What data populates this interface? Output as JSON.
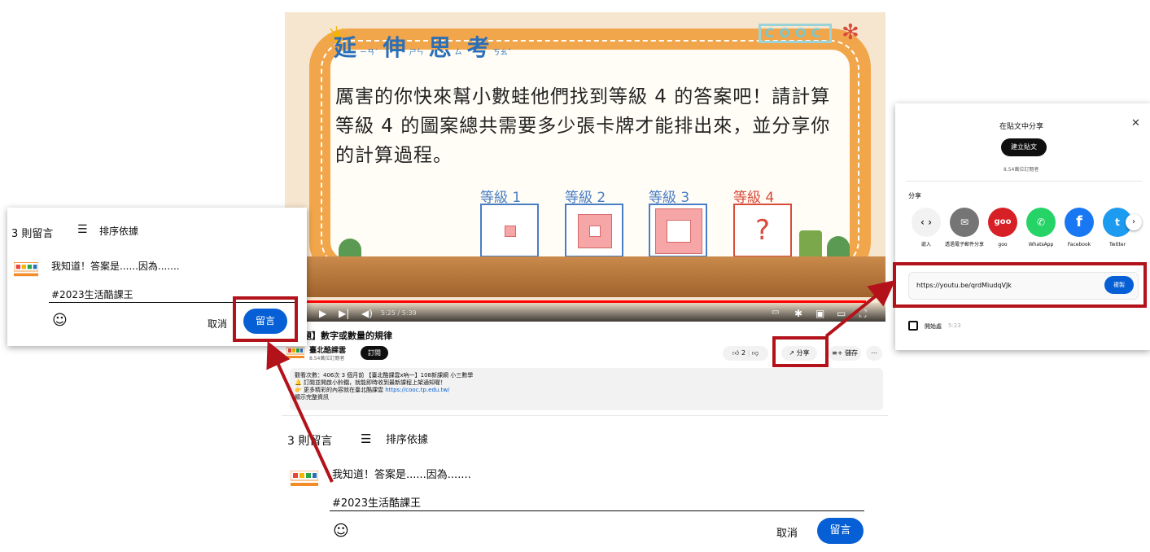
{
  "video": {
    "slide_title_chars": [
      {
        "c": "延",
        "r": "ㄧㄢˊ"
      },
      {
        "c": "伸",
        "r": "ㄕㄣ"
      },
      {
        "c": "思",
        "r": "ㄙ"
      },
      {
        "c": "考",
        "r": "ㄎㄠˇ"
      }
    ],
    "logo_text": "COOC",
    "slide_text": "厲害的你快來幫小數蛙他們找到等級 4 的答案吧！請計算等級 4 的圖案總共需要多少張卡牌才能排出來，並分享你的計算過程。",
    "levels": [
      {
        "label": "等級 1"
      },
      {
        "label": "等級 2"
      },
      {
        "label": "等級 3"
      },
      {
        "label": "等級 4",
        "mark": "?"
      }
    ],
    "time": "5:25 / 5:39",
    "progress": 0.98
  },
  "watch": {
    "title": "題】數字或數量的規律",
    "channel_name": "臺北酷課雲",
    "channel_subs": "8.54萬位訂閱者",
    "subscribe_label": "訂閱",
    "like_count": "2",
    "share_label": "分享",
    "save_label": "儲存",
    "more_label": "⋯",
    "description": {
      "line1": "觀看次數：406次 3 個月前 【臺北酷課雲x吶一】108新課綱 小三數學",
      "line2": "訂閱並開啟小鈴鐺，就能即時收到最新課程上架通知喔！",
      "line3_prefix": "更多精彩的內容就在臺北酷課雲 ",
      "line3_link": "https://cooc.tp.edu.tw/",
      "line4": "顯示完整資訊"
    }
  },
  "comments": {
    "count": "3 則留言",
    "sort_label": "排序依據",
    "draft_line1": "我知道！答案是......因為.......",
    "draft_line2": "#2023生活酷課王",
    "cancel_label": "取消",
    "submit_label": "留言"
  },
  "share": {
    "header": "在貼文中分享",
    "create_post_label": "建立貼文",
    "subs": "8.54萬位訂閱者",
    "section_label": "分享",
    "options": [
      {
        "name": "嵌入",
        "icon": "embed-icon",
        "color": "#f2f2f2",
        "glyph": "‹ ›"
      },
      {
        "name": "透過電子郵件分享",
        "icon": "email-icon",
        "color": "#757575",
        "glyph": "✉"
      },
      {
        "name": "goo",
        "icon": "goo-icon",
        "color": "#d71f26",
        "glyph": "goo"
      },
      {
        "name": "WhatsApp",
        "icon": "whatsapp-icon",
        "color": "#25d366",
        "glyph": "✆"
      },
      {
        "name": "Facebook",
        "icon": "facebook-icon",
        "color": "#1877f2",
        "glyph": "f"
      },
      {
        "name": "Twitter",
        "icon": "twitter-icon",
        "color": "#1d9bf0",
        "glyph": "t"
      }
    ],
    "url": "https://youtu.be/qrdMiudqVJk",
    "copy_label": "複製",
    "start_label": "開始處",
    "start_time": "5:23"
  },
  "colors": {
    "accent": "#065fd4",
    "highlight": "#b3121a"
  }
}
